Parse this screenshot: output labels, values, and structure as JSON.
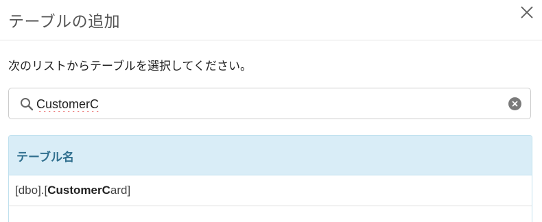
{
  "dialog": {
    "title": "テーブルの追加",
    "close_icon": "close-icon"
  },
  "instruction": "次のリストからテーブルを選択してください。",
  "search": {
    "icon": "search-icon",
    "value": "CustomerC",
    "clear_icon": "clear-icon"
  },
  "table": {
    "header": "テーブル名",
    "rows": [
      {
        "prefix": "[dbo].[",
        "match": "CustomerC",
        "suffix": "ard]"
      }
    ]
  },
  "colors": {
    "header_bg": "#d9edf7",
    "header_text": "#31708f",
    "border": "#bfe0ee"
  }
}
